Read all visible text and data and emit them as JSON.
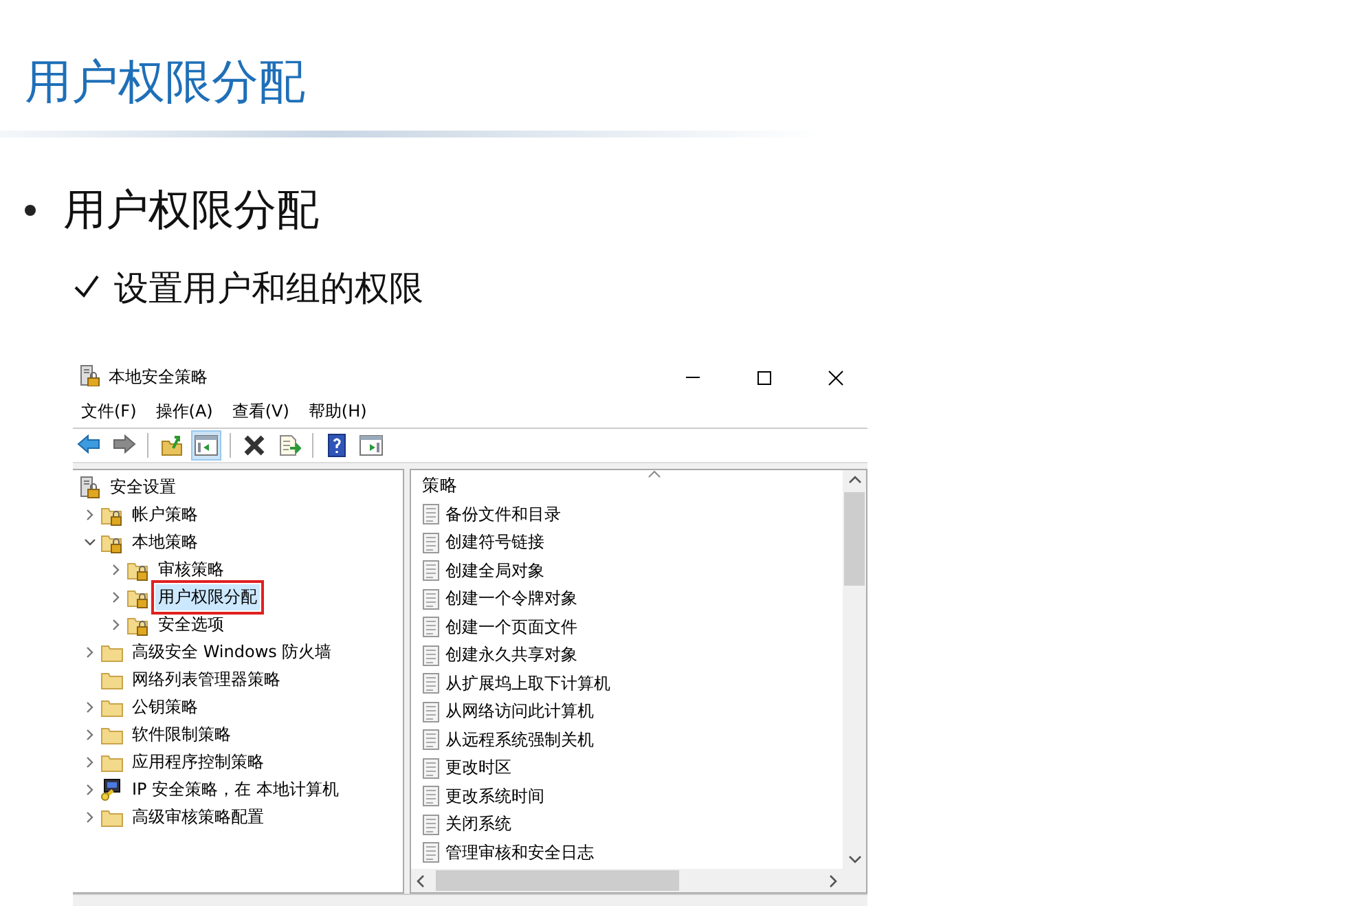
{
  "slide": {
    "title": "用户权限分配",
    "bullet": "用户权限分配",
    "check": "设置用户和组的权限"
  },
  "window": {
    "title": "本地安全策略",
    "menu": [
      "文件(F)",
      "操作(A)",
      "查看(V)",
      "帮助(H)"
    ],
    "toolbar": [
      {
        "kind": "back",
        "pressed": false
      },
      {
        "kind": "forward",
        "pressed": false
      },
      {
        "kind": "sep"
      },
      {
        "kind": "up",
        "pressed": false
      },
      {
        "kind": "tree",
        "pressed": true
      },
      {
        "kind": "sep"
      },
      {
        "kind": "delete",
        "pressed": false
      },
      {
        "kind": "export",
        "pressed": false
      },
      {
        "kind": "sep"
      },
      {
        "kind": "help",
        "pressed": false
      },
      {
        "kind": "pane",
        "pressed": false
      }
    ],
    "tree": {
      "label": "安全设置",
      "kind": "root",
      "selected": false,
      "children": [
        {
          "label": "帐户策略",
          "kind": "lockfolder",
          "expanded": false,
          "selected": false
        },
        {
          "label": "本地策略",
          "kind": "lockfolder",
          "expanded": true,
          "selected": false,
          "children": [
            {
              "label": "审核策略",
              "kind": "lockfolder",
              "expanded": false,
              "selected": false
            },
            {
              "label": "用户权限分配",
              "kind": "lockfolder",
              "expanded": false,
              "selected": true
            },
            {
              "label": "安全选项",
              "kind": "lockfolder",
              "expanded": false,
              "selected": false
            }
          ]
        },
        {
          "label": "高级安全 Windows 防火墙",
          "kind": "folder",
          "expanded": false,
          "selected": false
        },
        {
          "label": "网络列表管理器策略",
          "kind": "folder",
          "selected": false
        },
        {
          "label": "公钥策略",
          "kind": "folder",
          "expanded": false,
          "selected": false
        },
        {
          "label": "软件限制策略",
          "kind": "folder",
          "expanded": false,
          "selected": false
        },
        {
          "label": "应用程序控制策略",
          "kind": "folder",
          "expanded": false,
          "selected": false
        },
        {
          "label": "IP 安全策略，在 本地计算机",
          "kind": "ip",
          "expanded": false,
          "selected": false
        },
        {
          "label": "高级审核策略配置",
          "kind": "folder",
          "expanded": false,
          "selected": false
        }
      ]
    },
    "list": {
      "column": "策略",
      "items": [
        "备份文件和目录",
        "创建符号链接",
        "创建全局对象",
        "创建一个令牌对象",
        "创建一个页面文件",
        "创建永久共享对象",
        "从扩展坞上取下计算机",
        "从网络访问此计算机",
        "从远程系统强制关机",
        "更改时区",
        "更改系统时间",
        "关闭系统",
        "管理审核和安全日志"
      ]
    }
  }
}
